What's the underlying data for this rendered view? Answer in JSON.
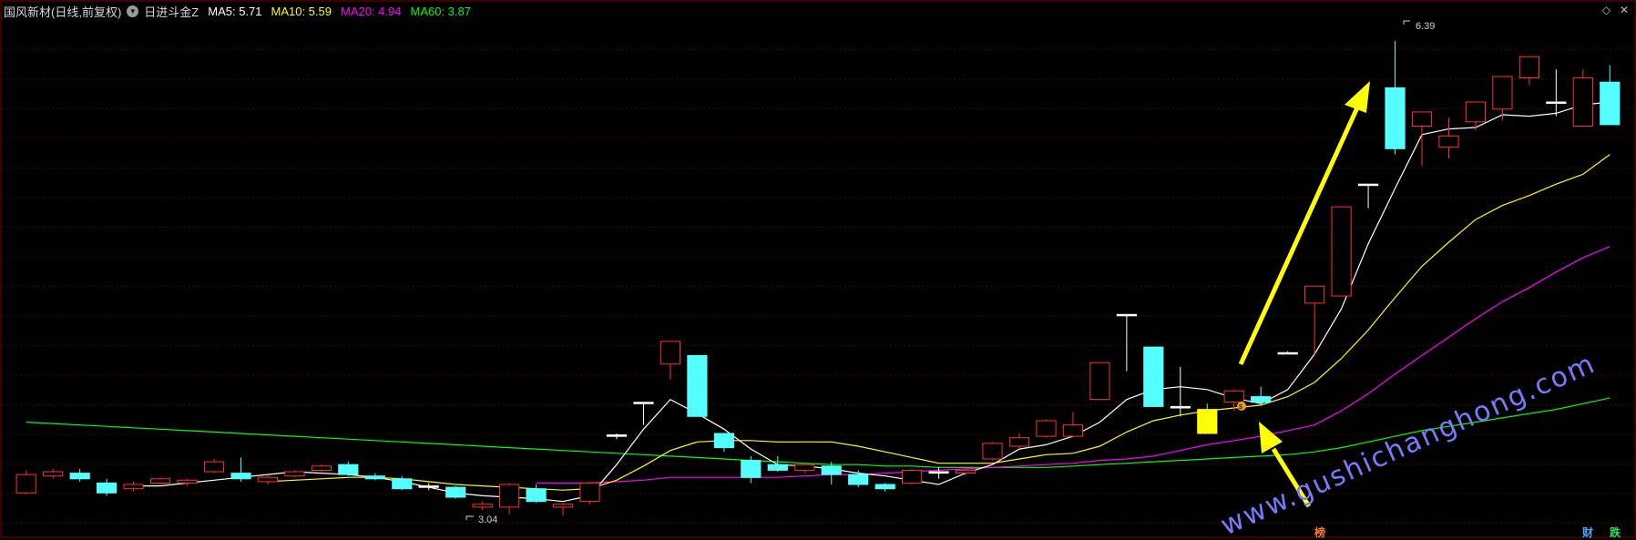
{
  "header": {
    "stock_name": "国风新材(日线,前复权)",
    "indicator_name": "日进斗金Z",
    "indicator_icon": "chevron-down-icon",
    "ma": [
      {
        "label": "MA5: 5.71",
        "color": "#ffffff"
      },
      {
        "label": "MA10: 5.59",
        "color": "#ffff00"
      },
      {
        "label": "MA20: 4.94",
        "color": "#ff00ff"
      },
      {
        "label": "MA60: 3.87",
        "color": "#00ff00"
      }
    ]
  },
  "top_icons": {
    "diamond": "◇",
    "close": "✕"
  },
  "colors": {
    "up": "#ff3030",
    "down": "#54ffff",
    "grid": "#4a0000",
    "arrow": "#ffff00",
    "watermark": "#7a7aff"
  },
  "badges": {
    "bang": "榜",
    "cai": "财",
    "die": "跌"
  },
  "chart_data": {
    "type": "candlestick",
    "y_axis": {
      "min": 2.9,
      "max": 6.5
    },
    "annotations": {
      "high_label": "6.39",
      "low_label": "3.04"
    },
    "watermark": "www.gushichanghong.com",
    "candles": [
      [
        3.2,
        3.33,
        3.19,
        3.36
      ],
      [
        3.32,
        3.35,
        3.3,
        3.37
      ],
      [
        3.34,
        3.3,
        3.28,
        3.37
      ],
      [
        3.27,
        3.2,
        3.18,
        3.3
      ],
      [
        3.23,
        3.26,
        3.21,
        3.28
      ],
      [
        3.27,
        3.3,
        3.25,
        3.31
      ],
      [
        3.27,
        3.29,
        3.25,
        3.3
      ],
      [
        3.35,
        3.42,
        3.34,
        3.44
      ],
      [
        3.34,
        3.3,
        3.28,
        3.45
      ],
      [
        3.28,
        3.31,
        3.26,
        3.33
      ],
      [
        3.32,
        3.35,
        3.31,
        3.36
      ],
      [
        3.36,
        3.39,
        3.35,
        3.4
      ],
      [
        3.4,
        3.33,
        3.32,
        3.42
      ],
      [
        3.32,
        3.3,
        3.29,
        3.34
      ],
      [
        3.3,
        3.23,
        3.22,
        3.32
      ],
      [
        3.25,
        3.24,
        3.22,
        3.27
      ],
      [
        3.24,
        3.17,
        3.16,
        3.25
      ],
      [
        3.1,
        3.12,
        3.08,
        3.14
      ],
      [
        3.1,
        3.26,
        3.05,
        3.27
      ],
      [
        3.23,
        3.14,
        3.13,
        3.26
      ],
      [
        3.1,
        3.12,
        3.04,
        3.13
      ],
      [
        3.14,
        3.27,
        3.12,
        3.28
      ],
      [
        3.61,
        3.6,
        3.58,
        3.62
      ],
      [
        3.84,
        3.84,
        3.68,
        3.84
      ],
      [
        4.11,
        4.27,
        4.0,
        4.27
      ],
      [
        4.17,
        3.74,
        3.74,
        4.17
      ],
      [
        3.62,
        3.52,
        3.49,
        3.62
      ],
      [
        3.43,
        3.31,
        3.27,
        3.46
      ],
      [
        3.4,
        3.36,
        3.35,
        3.46
      ],
      [
        3.36,
        3.4,
        3.34,
        3.41
      ],
      [
        3.39,
        3.33,
        3.26,
        3.42
      ],
      [
        3.33,
        3.26,
        3.24,
        3.36
      ],
      [
        3.26,
        3.23,
        3.21,
        3.27
      ],
      [
        3.27,
        3.36,
        3.26,
        3.37
      ],
      [
        3.34,
        3.35,
        3.3,
        3.38
      ],
      [
        3.34,
        3.36,
        3.32,
        3.37
      ],
      [
        3.44,
        3.55,
        3.43,
        3.56
      ],
      [
        3.53,
        3.59,
        3.51,
        3.62
      ],
      [
        3.6,
        3.71,
        3.59,
        3.72
      ],
      [
        3.6,
        3.68,
        3.59,
        3.77
      ],
      [
        3.86,
        4.12,
        3.86,
        4.12
      ],
      [
        4.46,
        4.46,
        4.06,
        4.46
      ],
      [
        4.23,
        3.81,
        3.81,
        4.23
      ],
      [
        3.81,
        3.8,
        3.74,
        4.09
      ],
      [
        3.79,
        3.62,
        3.66,
        3.83
      ],
      [
        3.84,
        3.92,
        3.78,
        3.93
      ],
      [
        3.88,
        3.84,
        3.84,
        3.95
      ],
      [
        4.19,
        4.19,
        4.18,
        4.2
      ],
      [
        4.54,
        4.66,
        4.18,
        4.66
      ],
      [
        4.59,
        5.22,
        4.59,
        5.22
      ],
      [
        5.38,
        5.38,
        5.21,
        5.38
      ],
      [
        6.06,
        5.63,
        5.59,
        6.39
      ],
      [
        5.79,
        5.89,
        5.51,
        5.89
      ],
      [
        5.64,
        5.72,
        5.56,
        5.85
      ],
      [
        5.82,
        5.96,
        5.76,
        5.96
      ],
      [
        5.91,
        6.14,
        5.83,
        6.14
      ],
      [
        6.13,
        6.28,
        6.08,
        6.28
      ],
      [
        5.96,
        5.96,
        5.86,
        6.19
      ],
      [
        5.79,
        6.13,
        5.79,
        6.19
      ],
      [
        6.1,
        5.8,
        5.81,
        6.22
      ]
    ],
    "ma5": [
      null,
      null,
      null,
      null,
      3.25,
      3.25,
      3.27,
      3.29,
      3.31,
      3.33,
      3.35,
      3.34,
      3.33,
      3.31,
      3.28,
      3.24,
      3.2,
      3.18,
      3.17,
      3.16,
      3.14,
      3.18,
      3.4,
      3.65,
      3.86,
      3.76,
      3.65,
      3.51,
      3.4,
      3.39,
      3.37,
      3.34,
      3.32,
      3.29,
      3.26,
      3.34,
      3.4,
      3.51,
      3.54,
      3.6,
      3.7,
      3.86,
      3.93,
      3.95,
      3.93,
      3.87,
      3.83,
      3.93,
      4.18,
      4.5,
      4.96,
      5.35,
      5.73,
      5.77,
      5.78,
      5.87,
      5.86,
      5.88,
      5.94,
      5.96
    ],
    "ma10": [
      null,
      null,
      null,
      null,
      null,
      null,
      null,
      null,
      null,
      3.28,
      3.29,
      3.3,
      3.31,
      3.31,
      3.3,
      3.28,
      3.26,
      3.25,
      3.24,
      3.23,
      3.22,
      3.23,
      3.29,
      3.39,
      3.5,
      3.56,
      3.57,
      3.57,
      3.56,
      3.56,
      3.56,
      3.53,
      3.49,
      3.45,
      3.41,
      3.41,
      3.41,
      3.44,
      3.47,
      3.48,
      3.53,
      3.63,
      3.71,
      3.75,
      3.78,
      3.8,
      3.82,
      3.88,
      3.98,
      4.15,
      4.35,
      4.58,
      4.8,
      4.97,
      5.13,
      5.23,
      5.3,
      5.38,
      5.45,
      5.59
    ],
    "ma20": [
      null,
      null,
      null,
      null,
      null,
      null,
      null,
      null,
      null,
      null,
      null,
      null,
      null,
      null,
      null,
      null,
      null,
      null,
      null,
      3.27,
      3.27,
      3.27,
      3.28,
      3.29,
      3.31,
      3.31,
      3.31,
      3.31,
      3.31,
      3.32,
      3.33,
      3.33,
      3.34,
      3.35,
      3.36,
      3.37,
      3.38,
      3.39,
      3.4,
      3.41,
      3.43,
      3.44,
      3.46,
      3.5,
      3.54,
      3.57,
      3.6,
      3.64,
      3.68,
      3.78,
      3.9,
      4.04,
      4.17,
      4.3,
      4.43,
      4.55,
      4.65,
      4.76,
      4.86,
      4.94
    ],
    "ma60": [
      3.7,
      3.69,
      3.68,
      3.67,
      3.66,
      3.65,
      3.64,
      3.63,
      3.62,
      3.61,
      3.6,
      3.59,
      3.58,
      3.57,
      3.56,
      3.55,
      3.54,
      3.53,
      3.52,
      3.51,
      3.5,
      3.49,
      3.48,
      3.47,
      3.46,
      3.45,
      3.44,
      3.43,
      3.42,
      3.41,
      3.4,
      3.4,
      3.39,
      3.39,
      3.38,
      3.38,
      3.38,
      3.38,
      3.38,
      3.39,
      3.4,
      3.41,
      3.42,
      3.43,
      3.44,
      3.45,
      3.46,
      3.47,
      3.49,
      3.52,
      3.56,
      3.6,
      3.64,
      3.67,
      3.7,
      3.73,
      3.76,
      3.79,
      3.83,
      3.87
    ]
  }
}
